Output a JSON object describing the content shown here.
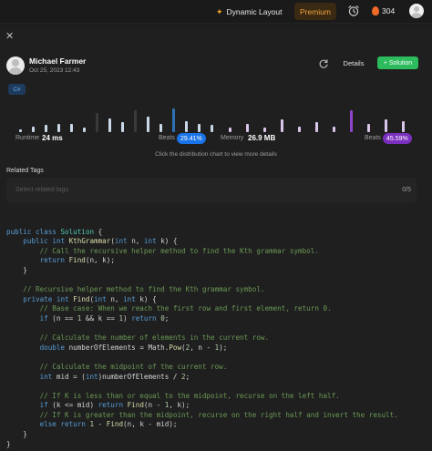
{
  "topbar": {
    "dynamic_layout": "Dynamic Layout",
    "premium": "Premium",
    "fire_count": "304"
  },
  "solution": {
    "close_glyph": "✕",
    "author": "Michael Farmer",
    "date": "Oct 25, 2023 12:43",
    "details_label": "Details",
    "solution_label": "+ Solution",
    "language": "C#"
  },
  "stats": {
    "runtime_label": "Runtime",
    "runtime_value": "24 ms",
    "runtime_beats_label": "Beats",
    "runtime_beats": "29.41%",
    "memory_label": "Memory",
    "memory_value": "26.9 MB",
    "memory_beats_label": "Beats",
    "memory_beats": "45.59%",
    "hint": "Click the distribution chart to view more details"
  },
  "distribution": {
    "runtime_bars": [
      0.1,
      0.2,
      0.25,
      0.3,
      0.3,
      0.15,
      0.7,
      0.5,
      0.35,
      0.8,
      0.55,
      0.3,
      0.85,
      0.4,
      0.3,
      0.25
    ],
    "runtime_highlight_index": 12,
    "memory_bars": [
      0.15,
      0.3,
      0.15,
      0.45,
      0.2,
      0.35,
      0.2,
      0.8,
      0.3,
      0.45,
      0.4
    ],
    "memory_highlight_index": 7,
    "colors": {
      "runtime": "#2f6fb3",
      "runtime_muted": "#3a3a3a",
      "runtime_light": "#c9d7e8",
      "memory": "#8e44c6",
      "memory_light": "#d9c6ea",
      "runtime_pill": "#1a73e8",
      "memory_pill": "#7b2fbe"
    }
  },
  "tags": {
    "title": "Related Tags",
    "placeholder": "Select related tags",
    "count": "0/5"
  },
  "code_lines": [
    [],
    [
      [
        "kw",
        "public "
      ],
      [
        "kw",
        "class "
      ],
      [
        "ty",
        "Solution"
      ],
      [
        "pl",
        " {"
      ]
    ],
    [
      [
        "pl",
        "    "
      ],
      [
        "kw",
        "public "
      ],
      [
        "kw",
        "int "
      ],
      [
        "fn",
        "KthGrammar"
      ],
      [
        "pl",
        "("
      ],
      [
        "kw",
        "int "
      ],
      [
        "pl",
        "n, "
      ],
      [
        "kw",
        "int "
      ],
      [
        "pl",
        "k) {"
      ]
    ],
    [
      [
        "pl",
        "        "
      ],
      [
        "cm",
        "// Call the recursive helper method to find the Kth grammar symbol."
      ]
    ],
    [
      [
        "pl",
        "        "
      ],
      [
        "kw",
        "return "
      ],
      [
        "fn",
        "Find"
      ],
      [
        "pl",
        "(n, k);"
      ]
    ],
    [
      [
        "pl",
        "    }"
      ]
    ],
    [],
    [
      [
        "pl",
        "    "
      ],
      [
        "cm",
        "// Recursive helper method to find the Kth grammar symbol."
      ]
    ],
    [
      [
        "pl",
        "    "
      ],
      [
        "kw",
        "private "
      ],
      [
        "kw",
        "int "
      ],
      [
        "fn",
        "Find"
      ],
      [
        "pl",
        "("
      ],
      [
        "kw",
        "int "
      ],
      [
        "pl",
        "n, "
      ],
      [
        "kw",
        "int "
      ],
      [
        "pl",
        "k) {"
      ]
    ],
    [
      [
        "pl",
        "        "
      ],
      [
        "cm",
        "// Base case: When we reach the first row and first element, return 0."
      ]
    ],
    [
      [
        "pl",
        "        "
      ],
      [
        "kw",
        "if "
      ],
      [
        "pl",
        "(n == "
      ],
      [
        "num",
        "1"
      ],
      [
        "pl",
        " && k == "
      ],
      [
        "num",
        "1"
      ],
      [
        "pl",
        ") "
      ],
      [
        "kw",
        "return "
      ],
      [
        "num",
        "0"
      ],
      [
        "pl",
        ";"
      ]
    ],
    [],
    [
      [
        "pl",
        "        "
      ],
      [
        "cm",
        "// Calculate the number of elements in the current row."
      ]
    ],
    [
      [
        "pl",
        "        "
      ],
      [
        "kw",
        "double "
      ],
      [
        "pl",
        "numberOfElements = Math."
      ],
      [
        "fn",
        "Pow"
      ],
      [
        "pl",
        "("
      ],
      [
        "num",
        "2"
      ],
      [
        "pl",
        ", n - "
      ],
      [
        "num",
        "1"
      ],
      [
        "pl",
        ");"
      ]
    ],
    [],
    [
      [
        "pl",
        "        "
      ],
      [
        "cm",
        "// Calculate the midpoint of the current row."
      ]
    ],
    [
      [
        "pl",
        "        "
      ],
      [
        "kw",
        "int "
      ],
      [
        "pl",
        "mid = ("
      ],
      [
        "kw",
        "int"
      ],
      [
        "pl",
        ")numberOfElements / "
      ],
      [
        "num",
        "2"
      ],
      [
        "pl",
        ";"
      ]
    ],
    [],
    [
      [
        "pl",
        "        "
      ],
      [
        "cm",
        "// If K is less than or equal to the midpoint, recurse on the left half."
      ]
    ],
    [
      [
        "pl",
        "        "
      ],
      [
        "kw",
        "if "
      ],
      [
        "pl",
        "(k <= mid) "
      ],
      [
        "kw",
        "return "
      ],
      [
        "fn",
        "Find"
      ],
      [
        "pl",
        "(n - "
      ],
      [
        "num",
        "1"
      ],
      [
        "pl",
        ", k);"
      ]
    ],
    [
      [
        "pl",
        "        "
      ],
      [
        "cm",
        "// If K is greater than the midpoint, recurse on the right half and invert the result."
      ]
    ],
    [
      [
        "pl",
        "        "
      ],
      [
        "kw",
        "else "
      ],
      [
        "kw",
        "return "
      ],
      [
        "num",
        "1"
      ],
      [
        "pl",
        " - "
      ],
      [
        "fn",
        "Find"
      ],
      [
        "pl",
        "(n, k - mid);"
      ]
    ],
    [
      [
        "pl",
        "    }"
      ]
    ],
    [
      [
        "pl",
        "}"
      ]
    ]
  ]
}
